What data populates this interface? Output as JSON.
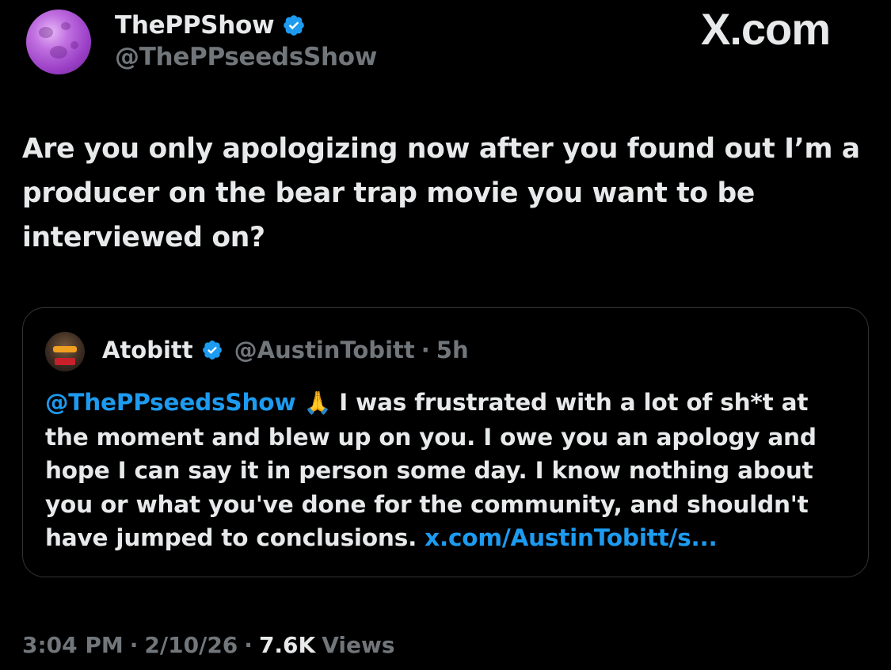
{
  "author": {
    "display_name": "ThePPShow",
    "handle": "@ThePPseedsShow",
    "avatar_icon": "purple-moon-avatar"
  },
  "brand": {
    "label": "X.com"
  },
  "tweet": {
    "text": "Are you only apologizing now after you found out I’m a producer on the bear trap movie you want to be interviewed on?"
  },
  "quoted": {
    "display_name": "Atobitt",
    "handle": "@AustinTobitt",
    "separator": "·",
    "time": "5h",
    "mention": "@ThePPseedsShow",
    "emoji": "🙏",
    "text": " I was frustrated with a lot of sh*t at the moment and blew up on you. I owe you an apology and hope I can say it in person some day. I know nothing about you or what you've done for the community, and shouldn't have jumped to conclusions. ",
    "link": "x.com/AustinTobitt/s..."
  },
  "footer": {
    "time": "3:04 PM",
    "sep1": "·",
    "date": "2/10/26",
    "sep2": "·",
    "views_count": "7.6K",
    "views_label": "Views"
  },
  "colors": {
    "background": "#000000",
    "text": "#e7e9ea",
    "muted": "#71767b",
    "link": "#1d9bf0",
    "verified": "#1d9bf0",
    "card_border": "#2f3336"
  }
}
